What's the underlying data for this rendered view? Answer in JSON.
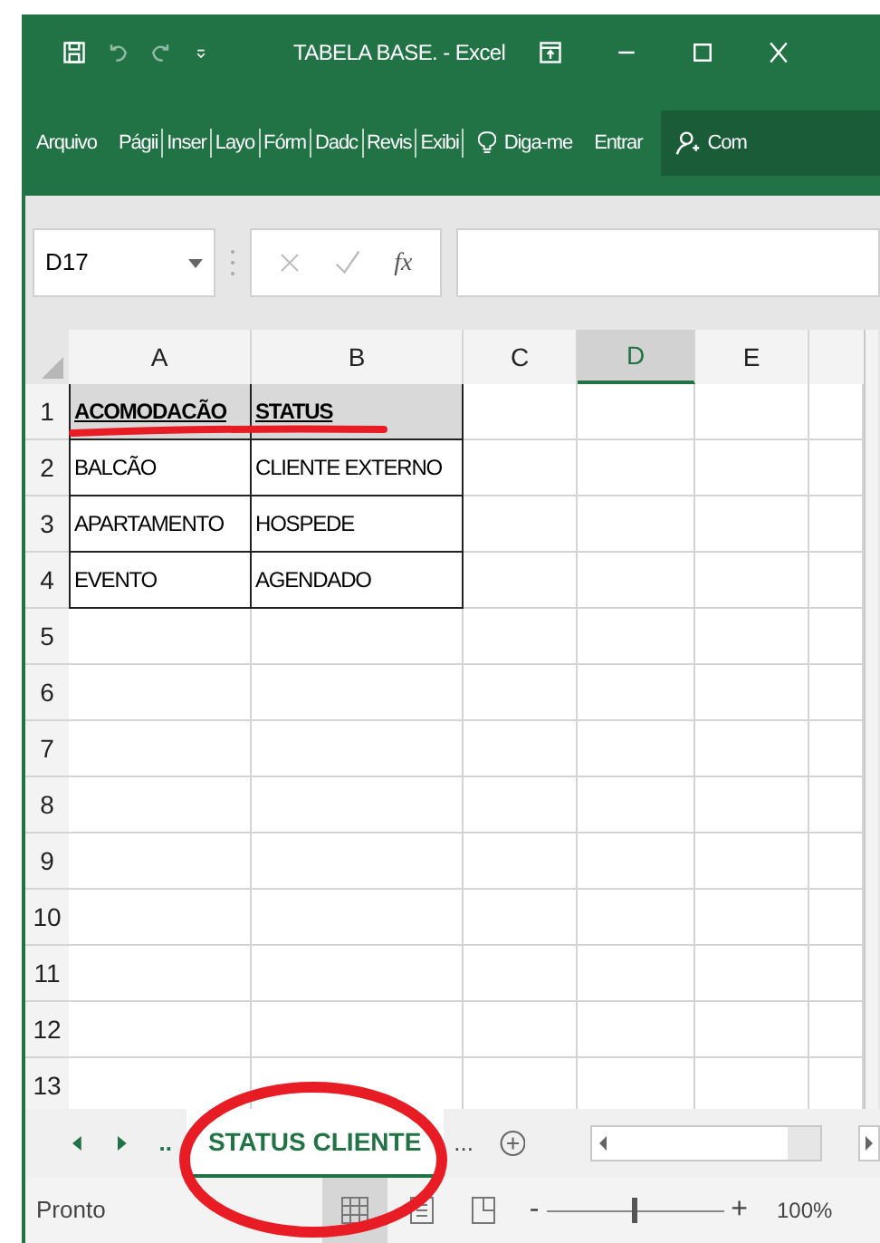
{
  "title_bar": {
    "title": "TABELA BASE. - Excel"
  },
  "ribbon": {
    "tabs": [
      {
        "label": "Arquivo"
      },
      {
        "label": "Págii"
      },
      {
        "label": "Inser"
      },
      {
        "label": "Layo"
      },
      {
        "label": "Fórm"
      },
      {
        "label": "Dadc"
      },
      {
        "label": "Revis"
      },
      {
        "label": "Exibi"
      }
    ],
    "tell_me": "Diga-me",
    "sign_in": "Entrar",
    "share": "Com"
  },
  "formula_bar": {
    "name_box": "D17",
    "fx": "fx"
  },
  "columns": [
    {
      "label": "A",
      "selected": false
    },
    {
      "label": "B",
      "selected": false
    },
    {
      "label": "C",
      "selected": false
    },
    {
      "label": "D",
      "selected": true
    },
    {
      "label": "E",
      "selected": false
    }
  ],
  "rows": [
    {
      "number": "1",
      "kind": "header",
      "cells": [
        "ACOMODACÃO",
        "STATUS"
      ]
    },
    {
      "number": "2",
      "kind": "data",
      "cells": [
        "BALCÃO",
        "CLIENTE EXTERNO"
      ]
    },
    {
      "number": "3",
      "kind": "data",
      "cells": [
        "APARTAMENTO",
        "HOSPEDE"
      ]
    },
    {
      "number": "4",
      "kind": "data",
      "cells": [
        "EVENTO",
        "AGENDADO"
      ]
    },
    {
      "number": "5",
      "kind": "empty"
    },
    {
      "number": "6",
      "kind": "empty"
    },
    {
      "number": "7",
      "kind": "empty"
    },
    {
      "number": "8",
      "kind": "empty"
    },
    {
      "number": "9",
      "kind": "empty"
    },
    {
      "number": "10",
      "kind": "empty"
    },
    {
      "number": "11",
      "kind": "empty"
    },
    {
      "number": "12",
      "kind": "empty"
    },
    {
      "number": "13",
      "kind": "empty"
    }
  ],
  "sheet_bar": {
    "overflow_left": "..",
    "tabs": [
      {
        "label": "STATUS CLIENTE",
        "selected": true
      }
    ],
    "overflow_right": "..."
  },
  "status_bar": {
    "status": "Pronto",
    "zoom": {
      "zoom_out": "-",
      "level": 0.5,
      "zoom_in": "+",
      "reading": "100%"
    }
  }
}
